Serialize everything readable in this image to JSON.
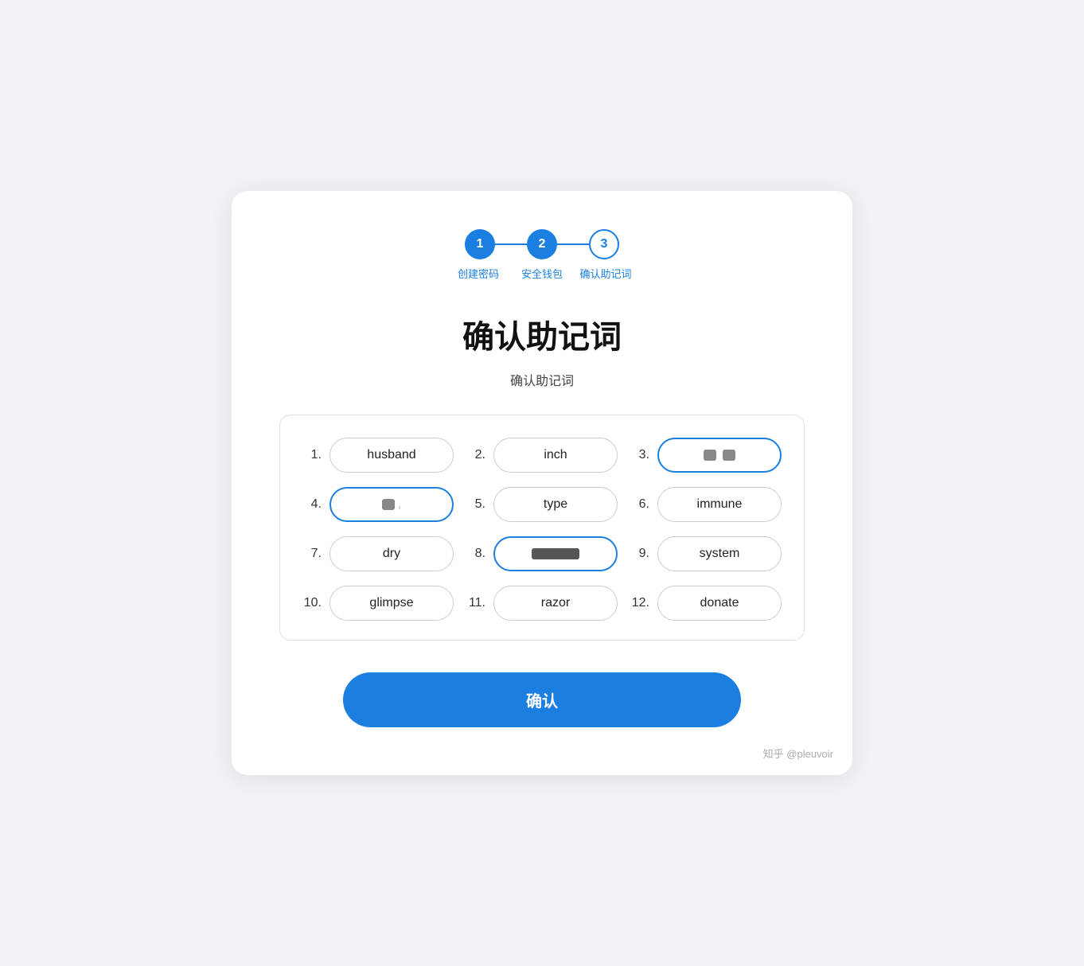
{
  "steps": {
    "items": [
      {
        "number": "1",
        "label": "创建密码",
        "state": "active"
      },
      {
        "number": "2",
        "label": "安全钱包",
        "state": "active"
      },
      {
        "number": "3",
        "label": "确认助记词",
        "state": "outline"
      }
    ]
  },
  "page": {
    "title": "确认助记词",
    "subtitle": "确认助记词",
    "confirm_button": "确认"
  },
  "words": [
    {
      "number": "1.",
      "word": "husband",
      "state": "normal"
    },
    {
      "number": "2.",
      "word": "inch",
      "state": "normal"
    },
    {
      "number": "3.",
      "word": "MASKED_3",
      "state": "highlighted-masked"
    },
    {
      "number": "4.",
      "word": "MASKED_4",
      "state": "highlighted-masked-single"
    },
    {
      "number": "5.",
      "word": "type",
      "state": "normal"
    },
    {
      "number": "6.",
      "word": "immune",
      "state": "normal"
    },
    {
      "number": "7.",
      "word": "dry",
      "state": "normal"
    },
    {
      "number": "8.",
      "word": "MASKED_8",
      "state": "masked-outlined"
    },
    {
      "number": "9.",
      "word": "system",
      "state": "normal"
    },
    {
      "number": "10.",
      "word": "glimpse",
      "state": "normal"
    },
    {
      "number": "11.",
      "word": "razor",
      "state": "normal"
    },
    {
      "number": "12.",
      "word": "donate",
      "state": "normal"
    }
  ],
  "watermark": "知乎 @pleuvoir"
}
